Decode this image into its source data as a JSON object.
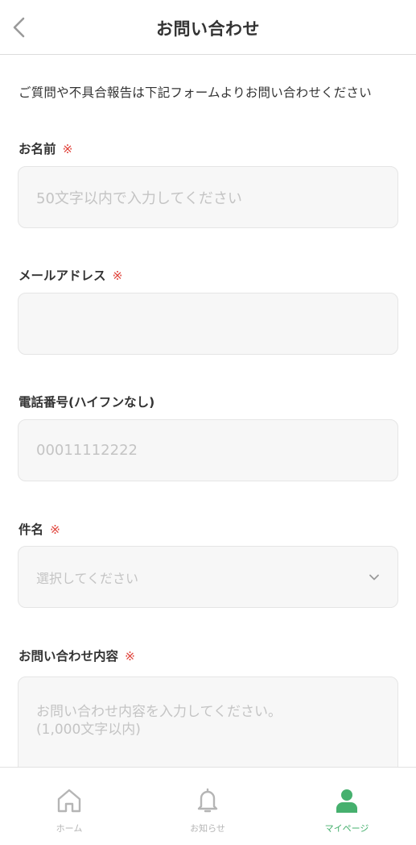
{
  "header": {
    "title": "お問い合わせ"
  },
  "intro": "ご質問や不具合報告は下記フォームよりお問い合わせください",
  "required_mark": "※",
  "fields": {
    "name": {
      "label": "お名前",
      "placeholder": "50文字以内で入力してください"
    },
    "email": {
      "label": "メールアドレス",
      "placeholder": ""
    },
    "phone": {
      "label": "電話番号(ハイフンなし)",
      "placeholder": "00011112222"
    },
    "subject": {
      "label": "件名",
      "selected": "選択してください"
    },
    "message": {
      "label": "お問い合わせ内容",
      "placeholder": "お問い合わせ内容を入力してください。\n(1,000文字以内)"
    }
  },
  "nav": {
    "home": {
      "label": "ホーム",
      "icon": "home-icon"
    },
    "news": {
      "label": "お知らせ",
      "icon": "bell-icon"
    },
    "mypage": {
      "label": "マイページ",
      "icon": "user-icon",
      "active": true
    }
  },
  "colors": {
    "accent": "#46b06e",
    "required": "#e0443c",
    "field_bg": "#f7f7f7"
  }
}
